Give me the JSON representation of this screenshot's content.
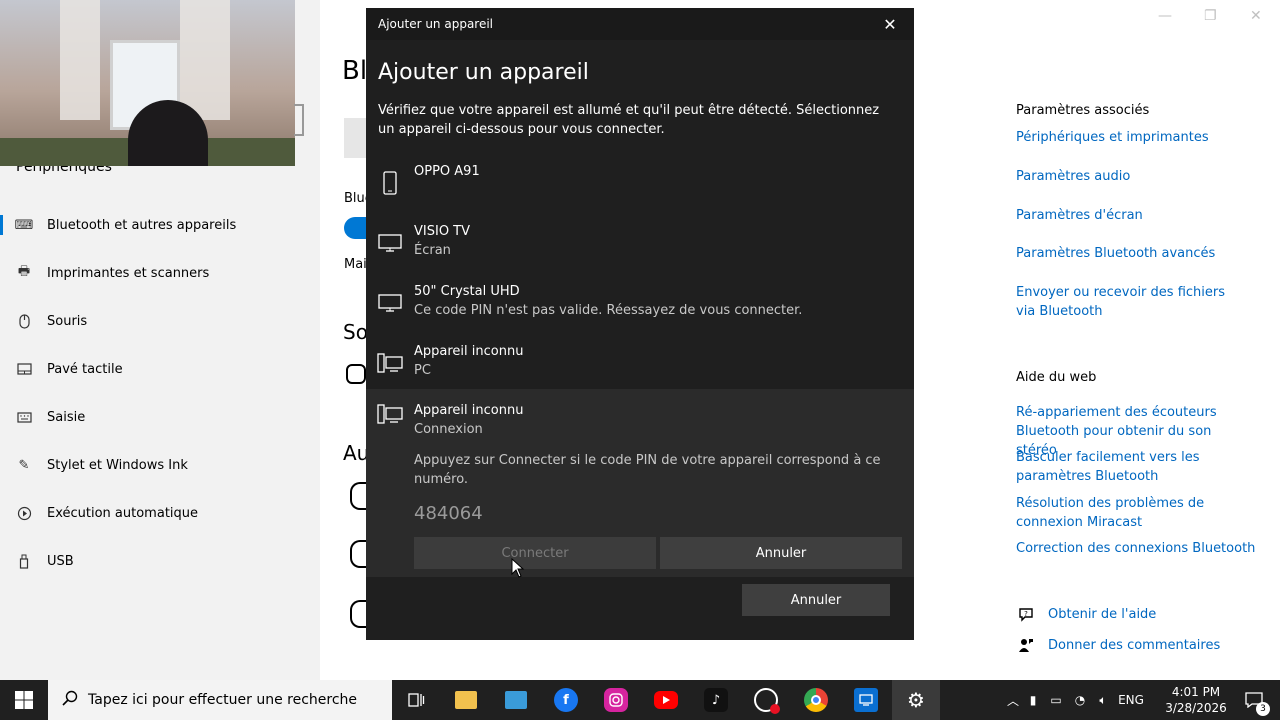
{
  "sidebar": {
    "partial_heading": "Périphériques",
    "items": [
      {
        "label": "Bluetooth et autres appareils",
        "icon": "bluetooth-devices-icon",
        "active": true
      },
      {
        "label": "Imprimantes et scanners",
        "icon": "printer-icon"
      },
      {
        "label": "Souris",
        "icon": "mouse-icon"
      },
      {
        "label": "Pavé tactile",
        "icon": "touchpad-icon"
      },
      {
        "label": "Saisie",
        "icon": "keyboard-icon"
      },
      {
        "label": "Stylet et Windows Ink",
        "icon": "pen-icon"
      },
      {
        "label": "Exécution automatique",
        "icon": "autoplay-icon"
      },
      {
        "label": "USB",
        "icon": "usb-icon"
      }
    ]
  },
  "main_partial": {
    "title": "Bl",
    "bluetooth_label": "Blue",
    "mai": "Mai",
    "section_so": "So",
    "section_au": "Au"
  },
  "right_panel": {
    "related_heading": "Paramètres associés",
    "related_links": [
      "Périphériques et imprimantes",
      "Paramètres audio",
      "Paramètres d'écran",
      "Paramètres Bluetooth avancés",
      "Envoyer ou recevoir des fichiers via Bluetooth"
    ],
    "web_heading": "Aide du web",
    "web_links": [
      "Ré-appariement des écouteurs Bluetooth pour obtenir du son stéréo",
      "Basculer facilement vers les paramètres Bluetooth",
      "Résolution des problèmes de connexion Miracast",
      "Correction des connexions Bluetooth"
    ],
    "help_label": "Obtenir de l'aide",
    "feedback_label": "Donner des commentaires"
  },
  "dialog": {
    "window_title": "Ajouter un appareil",
    "heading": "Ajouter un appareil",
    "description": "Vérifiez que votre appareil est allumé et qu'il peut être détecté. Sélectionnez un appareil ci-dessous pour vous connecter.",
    "devices": [
      {
        "name": "OPPO A91",
        "subtitle": "",
        "icon": "phone-icon"
      },
      {
        "name": "VISIO TV",
        "subtitle": "Écran",
        "icon": "monitor-icon"
      },
      {
        "name": "50\" Crystal UHD",
        "subtitle": "Ce code PIN n'est pas valide. Réessayez de vous connecter.",
        "icon": "monitor-icon"
      },
      {
        "name": "Appareil inconnu",
        "subtitle": "PC",
        "icon": "pc-icon"
      },
      {
        "name": "Appareil inconnu",
        "subtitle": "Connexion",
        "icon": "pc-icon"
      }
    ],
    "pin_message": "Appuyez sur Connecter si le code PIN de votre appareil correspond à ce numéro.",
    "pin": "484064",
    "connect_label": "Connecter",
    "cancel_inline_label": "Annuler",
    "cancel_label": "Annuler"
  },
  "taskbar": {
    "search_placeholder": "Tapez ici pour effectuer une recherche",
    "apps": [
      {
        "name": "task-view-icon",
        "color": "#202020"
      },
      {
        "name": "file-explorer-icon",
        "color": "#f2c14e"
      },
      {
        "name": "photos-icon",
        "color": "#3a9bd9"
      },
      {
        "name": "facebook-icon",
        "color": "#1877f2"
      },
      {
        "name": "instagram-icon",
        "color": "#d6249f"
      },
      {
        "name": "youtube-icon",
        "color": "#ff0000"
      },
      {
        "name": "tiktok-icon",
        "color": "#111111"
      },
      {
        "name": "screen-recorder-icon",
        "color": "#2a2a2a"
      },
      {
        "name": "chrome-icon",
        "color": "#34a853"
      },
      {
        "name": "connect-icon",
        "color": "#0a6fd1"
      },
      {
        "name": "settings-icon",
        "color": "#3a3a3a"
      }
    ],
    "language": "ENG",
    "time": "4:01 PM",
    "date": "3/28/2026",
    "notification_count": "3"
  }
}
